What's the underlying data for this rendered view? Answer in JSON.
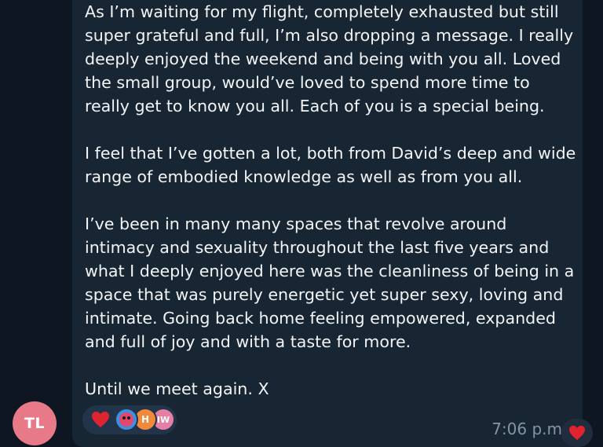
{
  "message": {
    "text": "As I’m waiting for my flight, completely exhausted but still\nsuper grateful and full, I’m also dropping a message. I really\ndeeply enjoyed the weekend and being with you all. Loved\nthe small group, would’ve loved to spend more time to\nreally get to know you all. Each of you is a special being.\n\nI feel that I’ve gotten a lot, both from David’s deep and wide\nrange of embodied knowledge as well as from you all.\n\nI’ve been in many many spaces that revolve around\nintimacy and sexuality throughout the last five years and\nwhat I deeply enjoyed here was the cleanliness of being in a\nspace that was purely energetic yet super sexy, loving and\nintimate. Going back home feeling empowered, expanded\nand full of joy and with a taste for more.\n\nUntil we meet again. X",
    "time": "7:06 p.m"
  },
  "sender": {
    "initials": "TL",
    "avatar_color": "#e77a86"
  },
  "reactions": {
    "emoji_icon": "red-heart-icon",
    "reactors": [
      {
        "type": "emoji-avatar",
        "icon": "pink-face-icon"
      },
      {
        "type": "initial",
        "label": "H"
      },
      {
        "type": "initial",
        "label": "IW"
      }
    ],
    "own_reaction_icon": "red-heart-icon"
  },
  "colors": {
    "background": "#0e1621",
    "bubble": "#182533",
    "text": "#f2f4f6",
    "meta": "#8494a5",
    "heart": "#e0242f"
  }
}
